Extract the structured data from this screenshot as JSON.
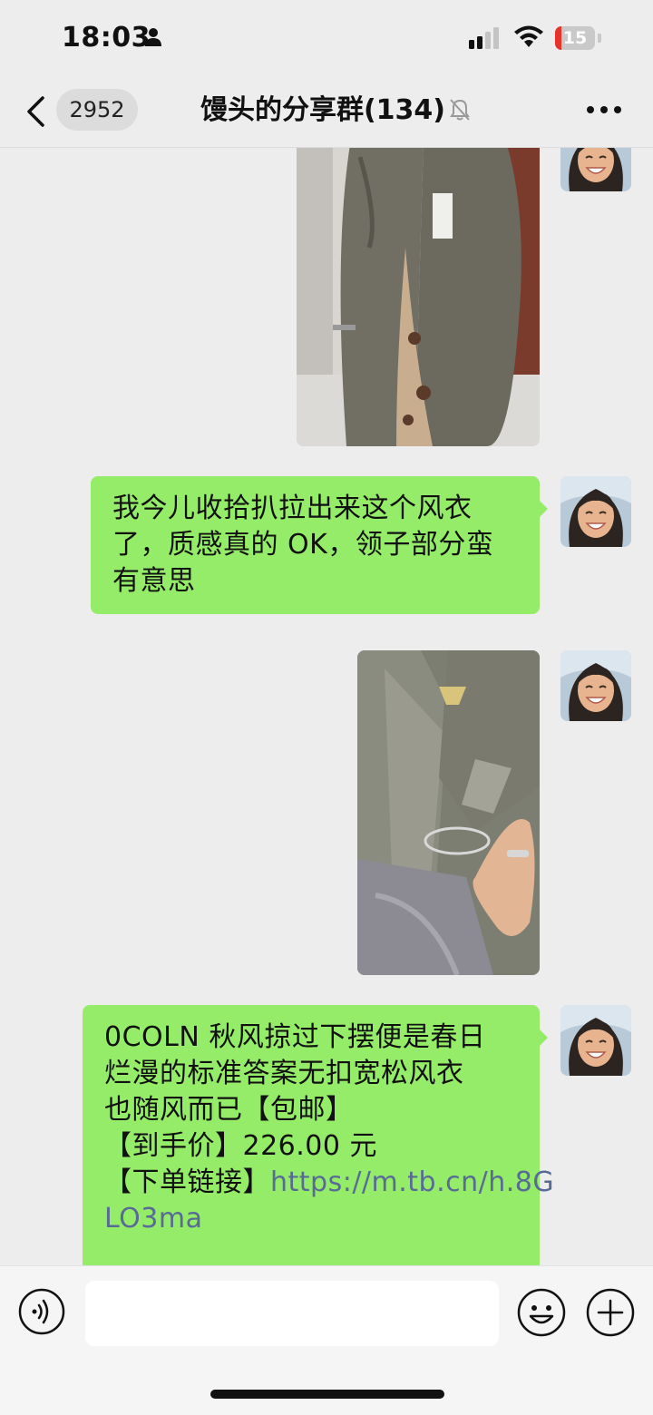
{
  "status_bar": {
    "time": "18:03",
    "battery_level": "15",
    "battery_fraction": 0.15,
    "battery_color": "#e8322a"
  },
  "nav": {
    "back_icon": "chevron-left-icon",
    "unread_count": "2952",
    "title": "馒头的分享群(134)",
    "mute_icon": "bell-off-icon",
    "more_icon": "more-dots-icon"
  },
  "messages": [
    {
      "type": "image",
      "sender": "self",
      "description_icon": "photo-trench-coat"
    },
    {
      "type": "text",
      "sender": "self",
      "lines": [
        "我今儿收拾扒拉出来这个风衣",
        "了，质感真的 OK，领子部分蛮",
        "有意思"
      ]
    },
    {
      "type": "image",
      "sender": "self",
      "description_icon": "photo-coat-collar"
    },
    {
      "type": "text",
      "sender": "self",
      "lines": [
        "0COLN 秋风掠过下摆便是春日",
        "烂漫的标准答案无扣宽松风衣",
        "也随风而已【包邮】",
        "【到手价】226.00 元"
      ],
      "link_prefix": "【下单链接】",
      "link_part1": "https://m.tb.cn/h.8G",
      "link_part2": "LO3ma"
    }
  ],
  "input_bar": {
    "voice_icon": "voice-icon",
    "placeholder": "",
    "emoji_icon": "emoji-icon",
    "plus_icon": "plus-icon"
  },
  "colors": {
    "bubble": "#95ec69",
    "link": "#576b95",
    "background": "#ededed"
  }
}
